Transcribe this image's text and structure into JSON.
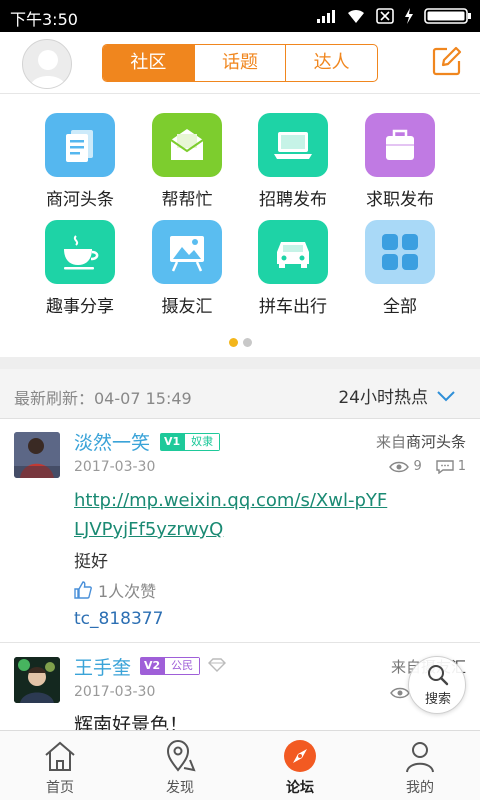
{
  "status_bar": {
    "time": "下午3:50",
    "icons": [
      "signal-icon",
      "wifi-icon",
      "sim-off-icon",
      "charging-icon",
      "battery-icon"
    ]
  },
  "header": {
    "tabs": [
      {
        "label": "社区",
        "active": true
      },
      {
        "label": "话题",
        "active": false
      },
      {
        "label": "达人",
        "active": false
      }
    ],
    "accent_color": "#f0861e",
    "icons": [
      "user-avatar-icon",
      "edit-icon"
    ]
  },
  "categories": [
    {
      "label": "商河头条",
      "icon": "news-icon",
      "color": "#55b7ef"
    },
    {
      "label": "帮帮忙",
      "icon": "mail-icon",
      "color": "#7dcd2e"
    },
    {
      "label": "招聘发布",
      "icon": "laptop-icon",
      "color": "#1ed3a6"
    },
    {
      "label": "求职发布",
      "icon": "briefcase-icon",
      "color": "#c07ae3"
    },
    {
      "label": "趣事分享",
      "icon": "cup-icon",
      "color": "#1ed3a6"
    },
    {
      "label": "摄友汇",
      "icon": "photo-easel-icon",
      "color": "#5abdf0"
    },
    {
      "label": "拼车出行",
      "icon": "car-icon",
      "color": "#1ed3a6"
    },
    {
      "label": "全部",
      "icon": "grid-icon",
      "color": "#a9d9f7"
    }
  ],
  "pager": {
    "pages": 2,
    "current": 1
  },
  "feed_header": {
    "refresh_text": "最新刷新：04-07 15:49",
    "sort_label": "24小时热点"
  },
  "posts": [
    {
      "username": "淡然一笑",
      "level": "V1",
      "rank": "奴隶",
      "from_prefix": "来自",
      "from_board": "商河头条",
      "date": "2017-03-30",
      "views": "9",
      "comments": "1",
      "link": "http://mp.weixin.qq.com/s/Xwl-pYFLJVPyjFf5yzrwyQ",
      "text": "挺好",
      "likes": "1人次赞",
      "tag": "tc_818377"
    },
    {
      "username": "王手奎",
      "level": "V2",
      "rank": "公民",
      "from_prefix": "来自",
      "from_board": "摄友汇",
      "date": "2017-03-30",
      "text": "辉南好景色！"
    }
  ],
  "search_fab": {
    "label": "搜索"
  },
  "bottom_nav": [
    {
      "label": "首页",
      "icon": "home-icon",
      "active": false
    },
    {
      "label": "发现",
      "icon": "location-icon",
      "active": false
    },
    {
      "label": "论坛",
      "icon": "compass-icon",
      "active": true
    },
    {
      "label": "我的",
      "icon": "person-icon",
      "active": false
    }
  ]
}
